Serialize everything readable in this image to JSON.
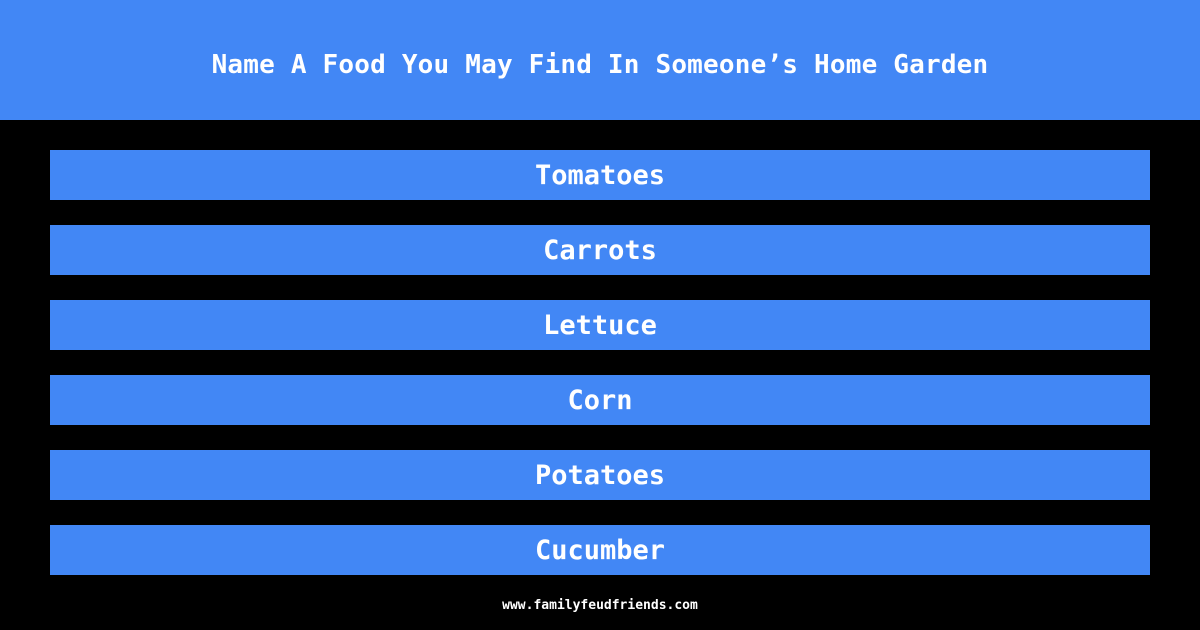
{
  "header": {
    "title": "Name A Food You May Find In Someone’s Home Garden"
  },
  "answers": [
    {
      "label": "Tomatoes"
    },
    {
      "label": "Carrots"
    },
    {
      "label": "Lettuce"
    },
    {
      "label": "Corn"
    },
    {
      "label": "Potatoes"
    },
    {
      "label": "Cucumber"
    }
  ],
  "footer": {
    "url": "www.familyfeudfriends.com"
  },
  "colors": {
    "accent": "#4287f5",
    "background": "#000000",
    "text": "#ffffff"
  }
}
